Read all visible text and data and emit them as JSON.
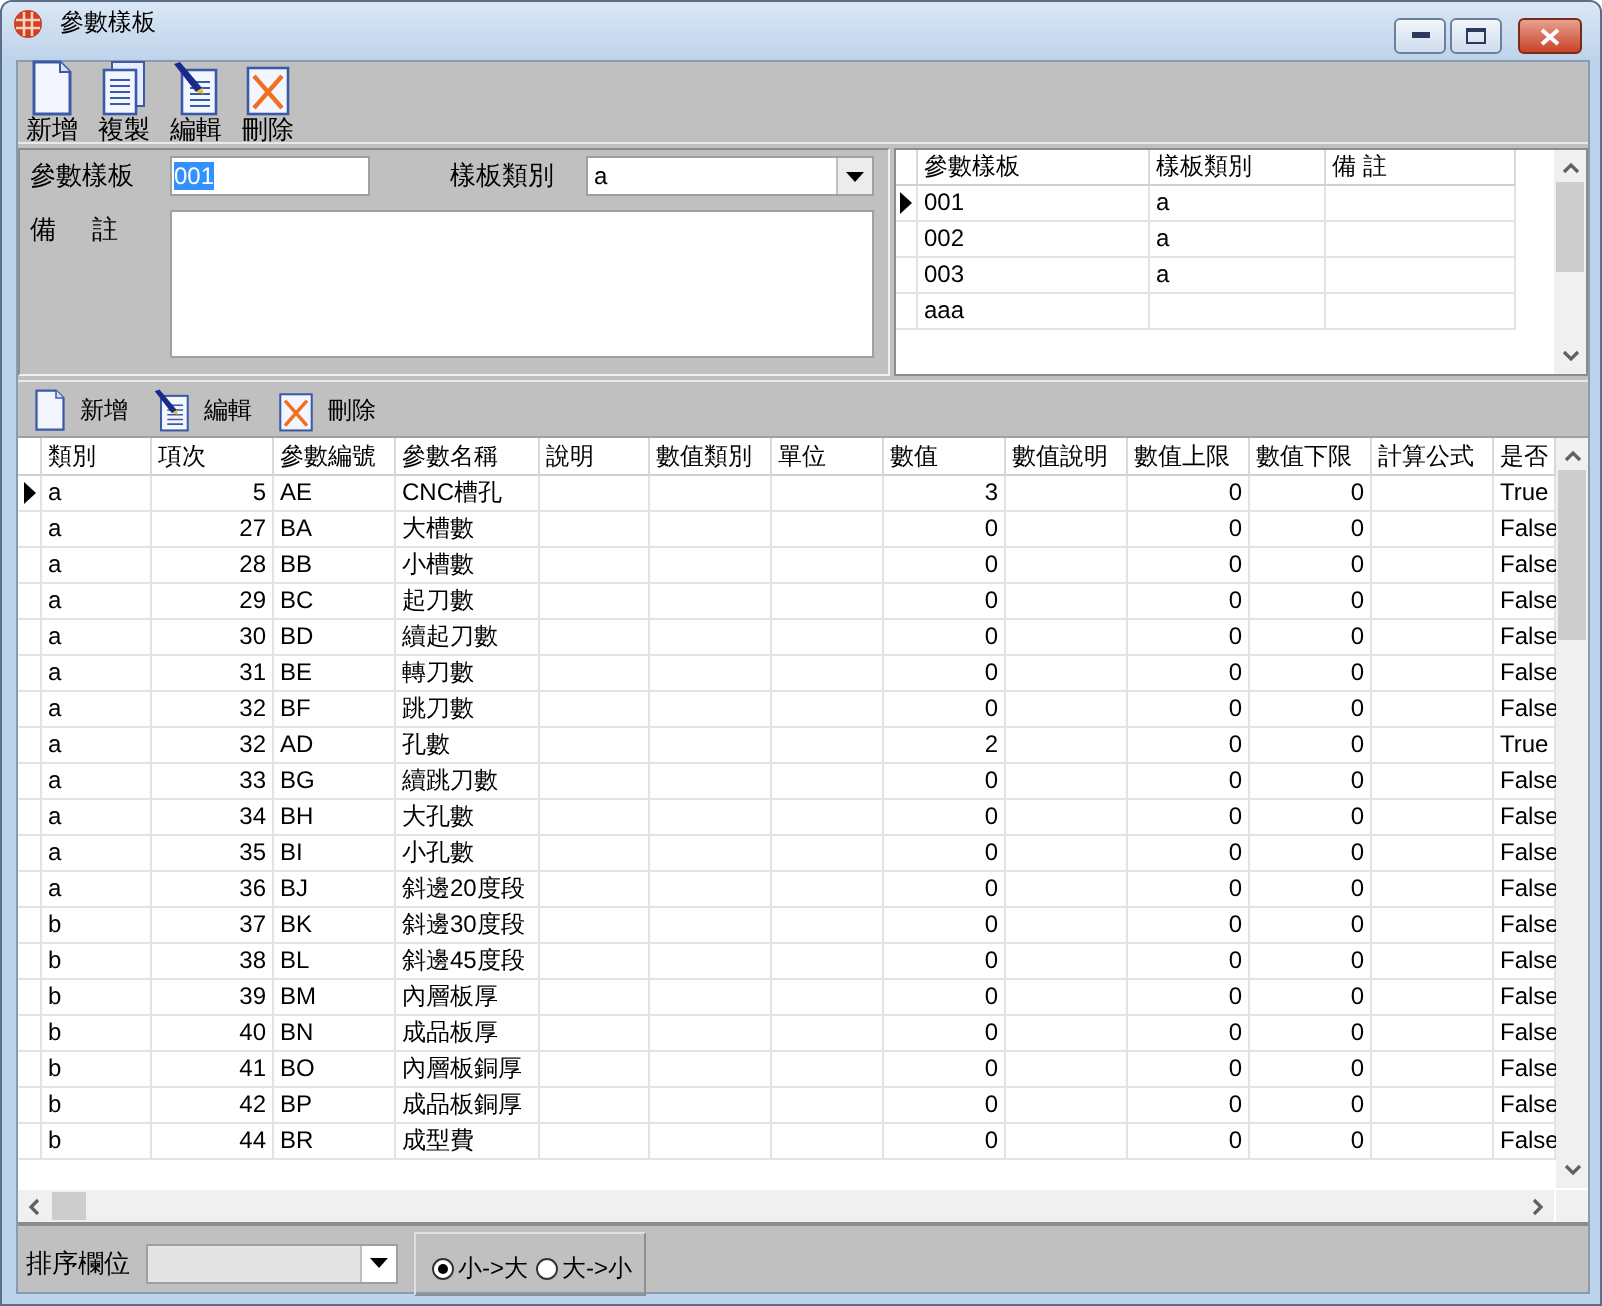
{
  "window": {
    "title": "參數樣板"
  },
  "toolbar": [
    {
      "kind": "new",
      "label": "新增"
    },
    {
      "kind": "copy",
      "label": "複製"
    },
    {
      "kind": "edit",
      "label": "編輯"
    },
    {
      "kind": "delete",
      "label": "刪除"
    }
  ],
  "form": {
    "template_label": "參數樣板",
    "template_value": "001",
    "category_label": "樣板類別",
    "category_value": "a",
    "note_label": "備 註"
  },
  "template_grid": {
    "columns": [
      "參數樣板",
      "樣板類別",
      "備 註"
    ],
    "rows": [
      {
        "template": "001",
        "category": "a",
        "selected": true
      },
      {
        "template": "002",
        "category": "a",
        "selected": false
      },
      {
        "template": "003",
        "category": "a",
        "selected": false
      },
      {
        "template": "aaa",
        "selected": false
      }
    ]
  },
  "detail_toolbar": [
    {
      "kind": "new",
      "label": "新增"
    },
    {
      "kind": "edit",
      "label": "編輯"
    },
    {
      "kind": "delete",
      "label": "刪除"
    }
  ],
  "table": {
    "columns": [
      "類別",
      "項次",
      "參數編號",
      "參數名稱",
      "說明",
      "數值類別",
      "單位",
      "數值",
      "數值說明",
      "數值上限",
      "數值下限",
      "計算公式",
      "是否"
    ],
    "rows": [
      {
        "category": "a",
        "item": "5",
        "code": "AE",
        "name": "CNC槽孔",
        "value": "3",
        "upper": "0",
        "lower": "0",
        "flag": "True",
        "selected": true
      },
      {
        "category": "a",
        "item": "27",
        "code": "BA",
        "name": "大槽數",
        "value": "0",
        "upper": "0",
        "lower": "0",
        "flag": "False",
        "selected": false
      },
      {
        "category": "a",
        "item": "28",
        "code": "BB",
        "name": "小槽數",
        "value": "0",
        "upper": "0",
        "lower": "0",
        "flag": "False",
        "selected": false
      },
      {
        "category": "a",
        "item": "29",
        "code": "BC",
        "name": "起刀數",
        "value": "0",
        "upper": "0",
        "lower": "0",
        "flag": "False",
        "selected": false
      },
      {
        "category": "a",
        "item": "30",
        "code": "BD",
        "name": "續起刀數",
        "value": "0",
        "upper": "0",
        "lower": "0",
        "flag": "False",
        "selected": false
      },
      {
        "category": "a",
        "item": "31",
        "code": "BE",
        "name": "轉刀數",
        "value": "0",
        "upper": "0",
        "lower": "0",
        "flag": "False",
        "selected": false
      },
      {
        "category": "a",
        "item": "32",
        "code": "BF",
        "name": "跳刀數",
        "value": "0",
        "upper": "0",
        "lower": "0",
        "flag": "False",
        "selected": false
      },
      {
        "category": "a",
        "item": "32",
        "code": "AD",
        "name": "孔數",
        "value": "2",
        "upper": "0",
        "lower": "0",
        "flag": "True",
        "selected": false
      },
      {
        "category": "a",
        "item": "33",
        "code": "BG",
        "name": "續跳刀數",
        "value": "0",
        "upper": "0",
        "lower": "0",
        "flag": "False",
        "selected": false
      },
      {
        "category": "a",
        "item": "34",
        "code": "BH",
        "name": "大孔數",
        "value": "0",
        "upper": "0",
        "lower": "0",
        "flag": "False",
        "selected": false
      },
      {
        "category": "a",
        "item": "35",
        "code": "BI",
        "name": "小孔數",
        "value": "0",
        "upper": "0",
        "lower": "0",
        "flag": "False",
        "selected": false
      },
      {
        "category": "a",
        "item": "36",
        "code": "BJ",
        "name": "斜邊20度段",
        "value": "0",
        "upper": "0",
        "lower": "0",
        "flag": "False",
        "selected": false
      },
      {
        "category": "b",
        "item": "37",
        "code": "BK",
        "name": "斜邊30度段",
        "value": "0",
        "upper": "0",
        "lower": "0",
        "flag": "False",
        "selected": false
      },
      {
        "category": "b",
        "item": "38",
        "code": "BL",
        "name": "斜邊45度段",
        "value": "0",
        "upper": "0",
        "lower": "0",
        "flag": "False",
        "selected": false
      },
      {
        "category": "b",
        "item": "39",
        "code": "BM",
        "name": "內層板厚",
        "value": "0",
        "upper": "0",
        "lower": "0",
        "flag": "False",
        "selected": false
      },
      {
        "category": "b",
        "item": "40",
        "code": "BN",
        "name": "成品板厚",
        "value": "0",
        "upper": "0",
        "lower": "0",
        "flag": "False",
        "selected": false
      },
      {
        "category": "b",
        "item": "41",
        "code": "BO",
        "name": "內層板銅厚",
        "value": "0",
        "upper": "0",
        "lower": "0",
        "flag": "False",
        "selected": false
      },
      {
        "category": "b",
        "item": "42",
        "code": "BP",
        "name": "成品板銅厚",
        "value": "0",
        "upper": "0",
        "lower": "0",
        "flag": "False",
        "selected": false
      },
      {
        "category": "b",
        "item": "44",
        "code": "BR",
        "name": "成型費",
        "value": "0",
        "upper": "0",
        "lower": "0",
        "flag": "False",
        "selected": false
      }
    ]
  },
  "sort": {
    "label": "排序欄位",
    "options": [
      {
        "label": "小->大",
        "selected": true
      },
      {
        "label": "大->小",
        "selected": false
      }
    ]
  }
}
